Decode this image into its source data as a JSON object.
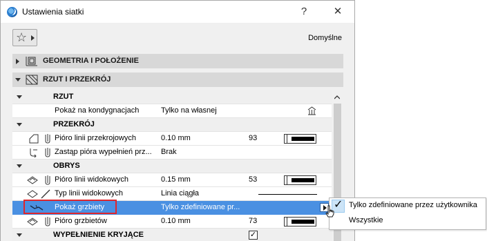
{
  "window": {
    "title": "Ustawienia siatki",
    "help_label": "?",
    "close_label": "✕"
  },
  "toolbar": {
    "favorites_icon": "star-icon",
    "default_label": "Domyślne"
  },
  "panels": [
    {
      "label": "GEOMETRIA I POŁOŻENIE",
      "expanded": false
    },
    {
      "label": "RZUT I PRZEKRÓJ",
      "expanded": true
    }
  ],
  "rows": [
    {
      "type": "group",
      "label": "RZUT"
    },
    {
      "type": "item",
      "name": "Pokaż na kondygnacjach",
      "value": "Tylko na własnej",
      "extra": "story-icon"
    },
    {
      "type": "group",
      "label": "PRZEKRÓJ"
    },
    {
      "type": "item",
      "name": "Pióro linii przekrojowych",
      "value": "0.10 mm",
      "num": "93",
      "extra": "pen"
    },
    {
      "type": "item",
      "name": "Zastąp pióra wypełnień prz...",
      "value": "Brak"
    },
    {
      "type": "group",
      "label": "OBRYS"
    },
    {
      "type": "item",
      "name": "Pióro linii widokowych",
      "value": "0.15 mm",
      "num": "53",
      "extra": "pen"
    },
    {
      "type": "item",
      "name": "Typ linii widokowych",
      "value": "Linia ciągła",
      "extra": "line"
    },
    {
      "type": "item",
      "name": "Pokaż grzbiety",
      "value": "Tylko zdefiniowane pr...",
      "extra": "dropdown",
      "selected": true
    },
    {
      "type": "item",
      "name": "Pióro grzbietów",
      "value": "0.10 mm",
      "num": "73",
      "extra": "pen"
    },
    {
      "type": "group",
      "label": "WYPEŁNIENIE KRYJĄCE",
      "check": "✓"
    }
  ],
  "popup": {
    "items": [
      {
        "label": "Tylko zdefiniowane przez użytkownika",
        "checked": "✓"
      },
      {
        "label": "Wszystkie",
        "checked": ""
      }
    ]
  },
  "colors": {
    "selection": "#4a90e2",
    "highlight_frame": "#e0262c"
  }
}
